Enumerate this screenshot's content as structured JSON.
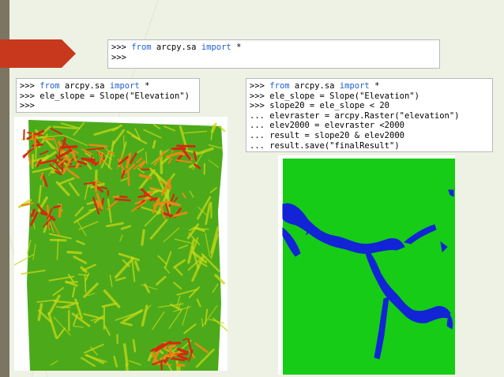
{
  "slide": {
    "accent_bar_color": "#7b7562",
    "arrow_color": "#c8381c"
  },
  "console_top": {
    "lines": [
      [
        {
          "t": ">>> "
        },
        {
          "t": "from",
          "kw": true
        },
        {
          "t": " arcpy.sa "
        },
        {
          "t": "import",
          "kw": true
        },
        {
          "t": " *"
        }
      ],
      [
        {
          "t": ">>>"
        }
      ]
    ]
  },
  "console_slope": {
    "lines": [
      [
        {
          "t": ">>> "
        },
        {
          "t": "from",
          "kw": true
        },
        {
          "t": " arcpy.sa "
        },
        {
          "t": "import",
          "kw": true
        },
        {
          "t": " *"
        }
      ],
      [
        {
          "t": ">>> ele_slope = Slope(\"Elevation\")"
        }
      ],
      [
        {
          "t": ">>>"
        }
      ]
    ]
  },
  "console_result": {
    "lines": [
      [
        {
          "t": ">>> "
        },
        {
          "t": "from",
          "kw": true
        },
        {
          "t": " arcpy.sa "
        },
        {
          "t": "import",
          "kw": true
        },
        {
          "t": " *"
        }
      ],
      [
        {
          "t": ">>> ele_slope = Slope(\"Elevation\")"
        }
      ],
      [
        {
          "t": ">>> slope20 = ele_slope < 20"
        }
      ],
      [
        {
          "t": "... elevraster = arcpy.Raster(\"elevation\")"
        }
      ],
      [
        {
          "t": "... elev2000 = elevraster <2000"
        }
      ],
      [
        {
          "t": "... result = slope20 & elev2000"
        }
      ],
      [
        {
          "t": "... result.save(\"finalResult\")"
        }
      ]
    ]
  },
  "slope_map": {
    "colors": {
      "green": "#4caa1a",
      "yellow": "#c7d814",
      "orange": "#e48a12",
      "red": "#d42a10"
    }
  },
  "result_map": {
    "colors": {
      "green": "#16cc16",
      "blue": "#1224d6"
    }
  }
}
